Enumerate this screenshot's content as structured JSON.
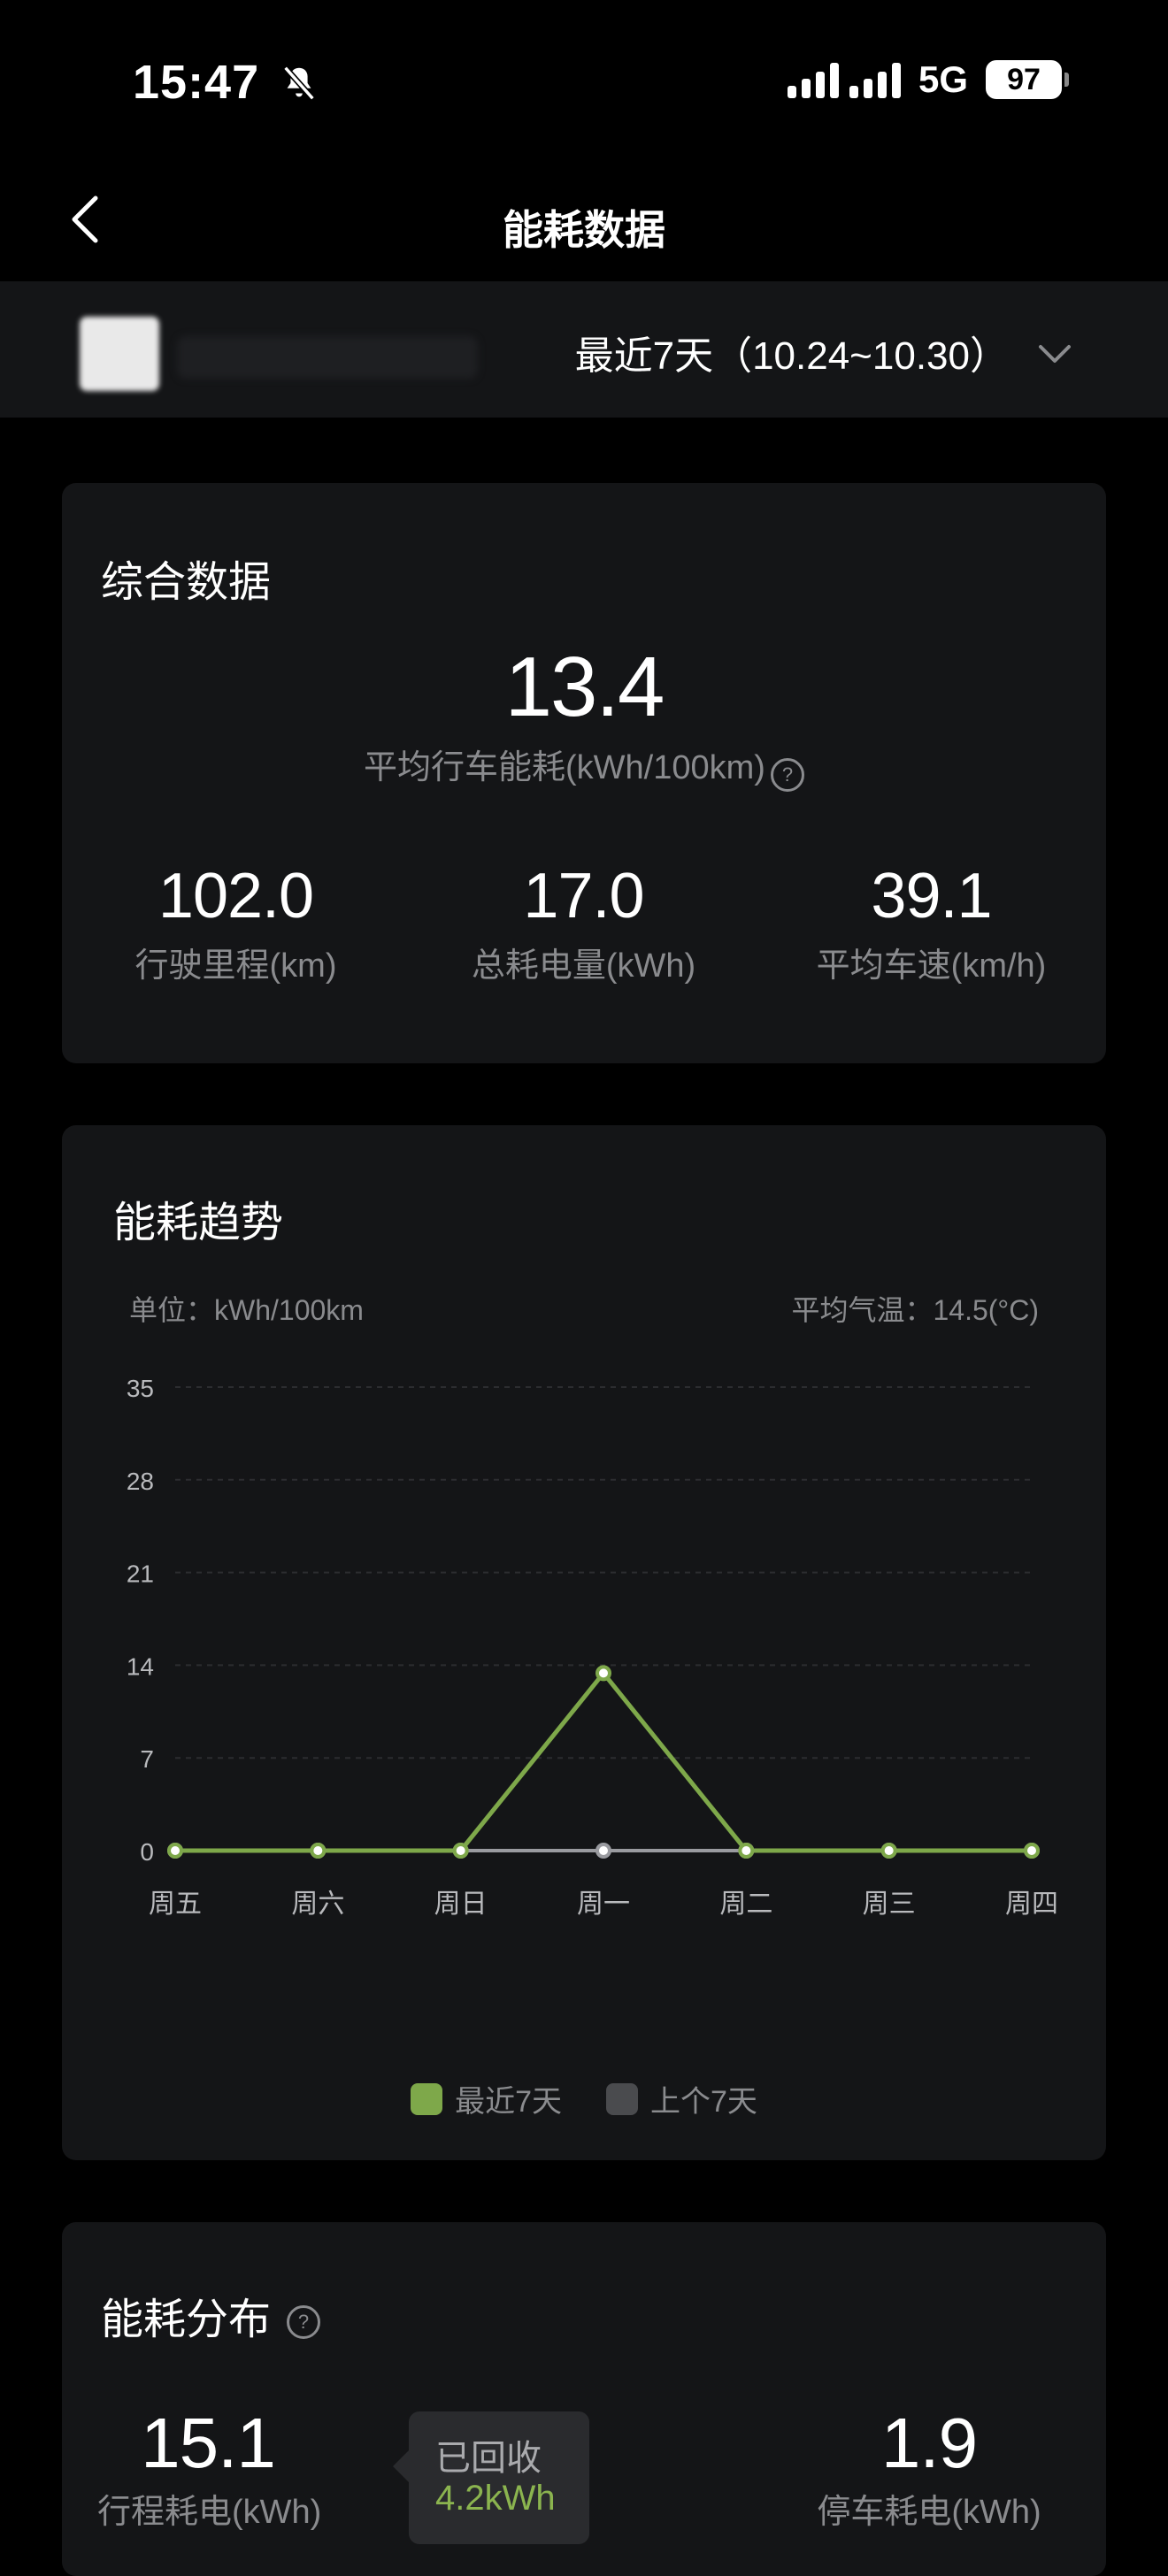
{
  "status_bar": {
    "time": "15:47",
    "network": "5G",
    "battery": "97"
  },
  "header": {
    "title": "能耗数据"
  },
  "filter": {
    "range_label": "最近7天（10.24~10.30）"
  },
  "summary": {
    "title": "综合数据",
    "avg_consumption_value": "13.4",
    "avg_consumption_label": "平均行车能耗(kWh/100km)",
    "metrics": [
      {
        "value": "102.0",
        "label": "行驶里程(km)"
      },
      {
        "value": "17.0",
        "label": "总耗电量(kWh)"
      },
      {
        "value": "39.1",
        "label": "平均车速(km/h)"
      }
    ]
  },
  "trend": {
    "title": "能耗趋势",
    "unit_label": "单位：kWh/100km",
    "temp_label": "平均气温：14.5(°C)",
    "legend": [
      {
        "label": "最近7天",
        "color": "#7ea84a"
      },
      {
        "label": "上个7天",
        "color": "#4a4b4e"
      }
    ]
  },
  "chart_data": {
    "type": "line",
    "categories": [
      "周五",
      "周六",
      "周日",
      "周一",
      "周二",
      "周三",
      "周四"
    ],
    "series": [
      {
        "name": "最近7天",
        "values": [
          0,
          0,
          0,
          13.4,
          0,
          0,
          0
        ],
        "color": "#7ea84a"
      },
      {
        "name": "上个7天",
        "values": [
          0,
          0,
          0,
          0,
          0,
          0,
          0
        ],
        "color": "#9a9ba0"
      }
    ],
    "yticks": [
      0,
      7,
      14,
      21,
      28,
      35
    ],
    "ylim": [
      0,
      35
    ],
    "grid": true
  },
  "distribution": {
    "title": "能耗分布",
    "trip_value": "15.1",
    "trip_label": "行程耗电(kWh)",
    "parking_value": "1.9",
    "parking_label": "停车耗电(kWh)",
    "recovered_title": "已回收",
    "recovered_value": "4.2kWh"
  }
}
